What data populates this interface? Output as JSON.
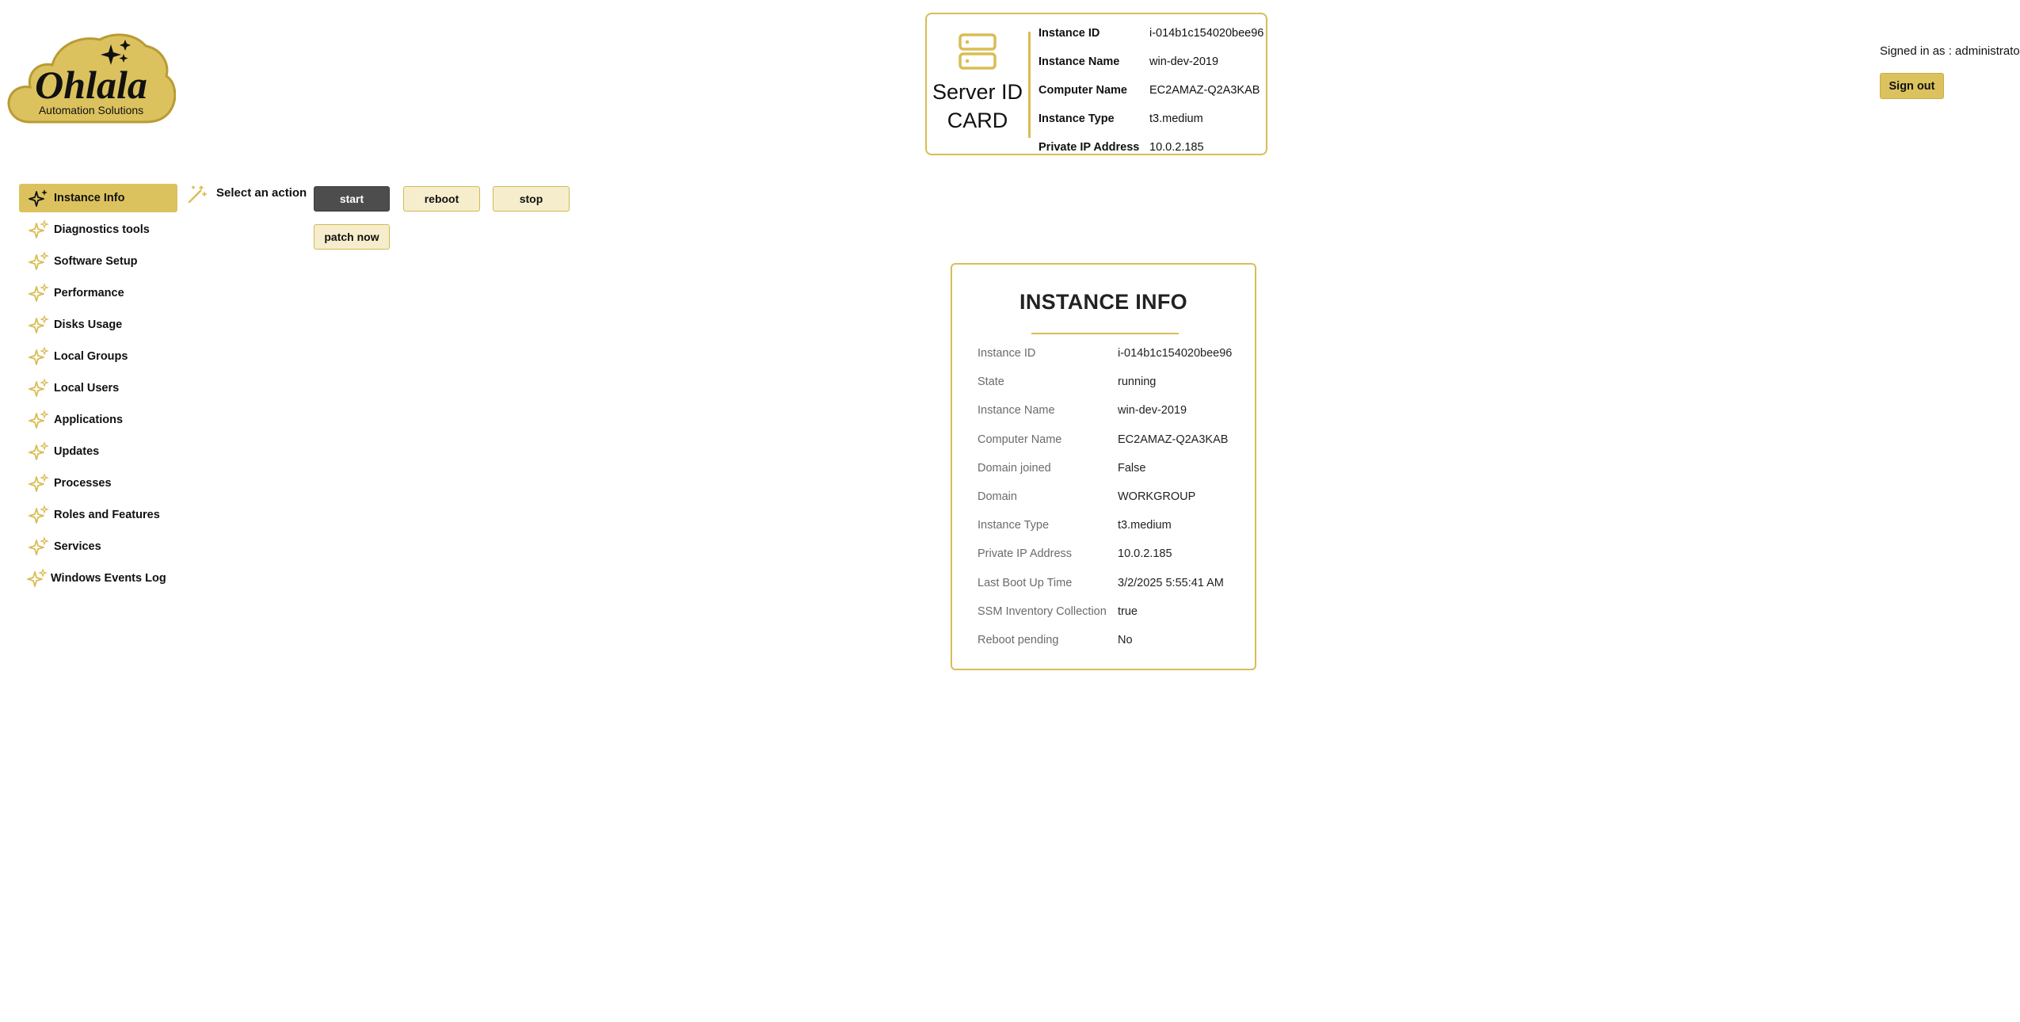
{
  "brand": {
    "logo_text": "Ohlala",
    "logo_subtext": "Automation Solutions",
    "accent_color": "#dcc25e",
    "border_color": "#d9bd55"
  },
  "server_card": {
    "title": "Server ID CARD",
    "icon": "server-icon",
    "rows": [
      {
        "label": "Instance ID",
        "value": "i-014b1c154020bee96"
      },
      {
        "label": "Instance Name",
        "value": "win-dev-2019"
      },
      {
        "label": "Computer Name",
        "value": "EC2AMAZ-Q2A3KAB"
      },
      {
        "label": "Instance Type",
        "value": "t3.medium"
      },
      {
        "label": "Private IP Address",
        "value": "10.0.2.185"
      }
    ]
  },
  "header": {
    "signed_in": "Signed in as : administrator",
    "sign_out": "Sign out"
  },
  "sidebar": {
    "icon": "sparkles-icon",
    "items": [
      {
        "label": "Instance Info",
        "active": true
      },
      {
        "label": "Diagnostics tools"
      },
      {
        "label": "Software Setup"
      },
      {
        "label": "Performance"
      },
      {
        "label": "Disks Usage"
      },
      {
        "label": "Local Groups"
      },
      {
        "label": "Local Users"
      },
      {
        "label": "Applications"
      },
      {
        "label": "Updates"
      },
      {
        "label": "Processes"
      },
      {
        "label": "Roles and Features"
      },
      {
        "label": "Services"
      },
      {
        "label": "Windows Events Log"
      }
    ]
  },
  "actions": {
    "icon": "magic-wand-icon",
    "label": "Select an action",
    "buttons": [
      "start",
      "reboot",
      "stop",
      "patch now"
    ]
  },
  "instance_info": {
    "title": "INSTANCE INFO",
    "rows": [
      {
        "label": "Instance ID",
        "value": "i-014b1c154020bee96"
      },
      {
        "label": "State",
        "value": "running"
      },
      {
        "label": "Instance Name",
        "value": "win-dev-2019"
      },
      {
        "label": "Computer Name",
        "value": "EC2AMAZ-Q2A3KAB"
      },
      {
        "label": "Domain joined",
        "value": "False"
      },
      {
        "label": "Domain",
        "value": "WORKGROUP"
      },
      {
        "label": "Instance Type",
        "value": "t3.medium"
      },
      {
        "label": "Private IP Address",
        "value": "10.0.2.185"
      },
      {
        "label": "Last Boot Up Time",
        "value": "3/2/2025 5:55:41 AM"
      },
      {
        "label": "SSM Inventory Collection",
        "value": "true"
      },
      {
        "label": "Reboot pending",
        "value": "No"
      }
    ]
  }
}
